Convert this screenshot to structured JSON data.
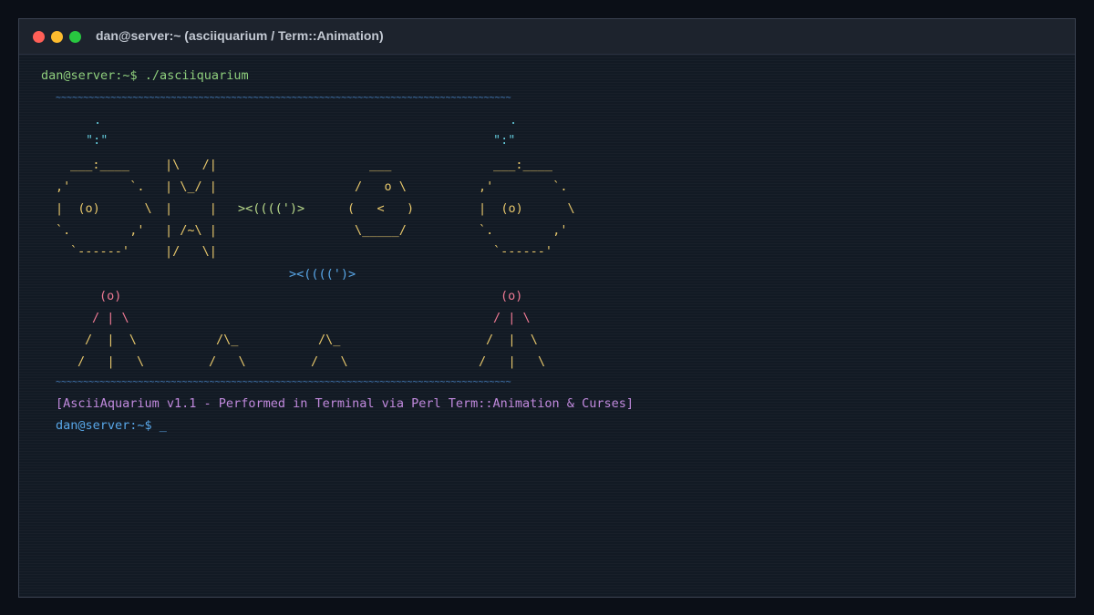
{
  "window": {
    "title": "dan@server:~ (asciiquarium / Term::Animation)"
  },
  "terminal": {
    "command_line": "dan@server:~$ ./asciiquarium",
    "water_top": "~~~~~~~~~~~~~~~~~~~~~~~~~~~~~~~~~~~~~~~~~~~~~~~~~~~~~~~~~~~~~~~~~~~~~~~~~~~~~~~~~~~",
    "water_bottom": "~~~~~~~~~~~~~~~~~~~~~~~~~~~~~~~~~~~~~~~~~~~~~~~~~~~~~~~~~~~~~~~~~~~~~~~~~~~~~~~~~~~",
    "aquarium": {
      "bubble_left_1": ".",
      "bubble_left_2": "\":\"",
      "whale_left": [
        "___:____",
        ",'        `.",
        "|  (o)      \\",
        "`.        ,'",
        "`------'"
      ],
      "butterflyfish": [
        "|\\   /|",
        "| \\_/ |",
        "|     |",
        "| /~\\ |",
        "|/   \\|"
      ],
      "fish_small_1": "><((((')>",
      "fish_small_2": "><((((')>",
      "pufferfish": [
        "___",
        "/   o \\",
        "(   <   )",
        "\\_____/"
      ],
      "bubble_right_1": ".",
      "bubble_right_2": "\":\"",
      "whale_right": [
        "___:____",
        ",'        `.",
        "|  (o)      \\",
        "`.        ,'",
        "`------'"
      ],
      "castle_left": [
        "(o)",
        "/ | \\",
        "/  |  \\",
        "/   |   \\"
      ],
      "rock_1": [
        "/\\_",
        "/   \\"
      ],
      "rock_2": [
        "/\\_",
        "/   \\"
      ],
      "castle_right": [
        "(o)",
        "/ | \\",
        "/  |  \\",
        "/   |   \\"
      ]
    },
    "banner": "[AsciiAquarium v1.1 - Performed in Terminal via Perl Term::Animation & Curses]",
    "prompt": "dan@server:~$ _"
  },
  "colors": {
    "prompt": "#8fcf7d",
    "water": "#4a86c9",
    "banner": "#c089dd"
  }
}
